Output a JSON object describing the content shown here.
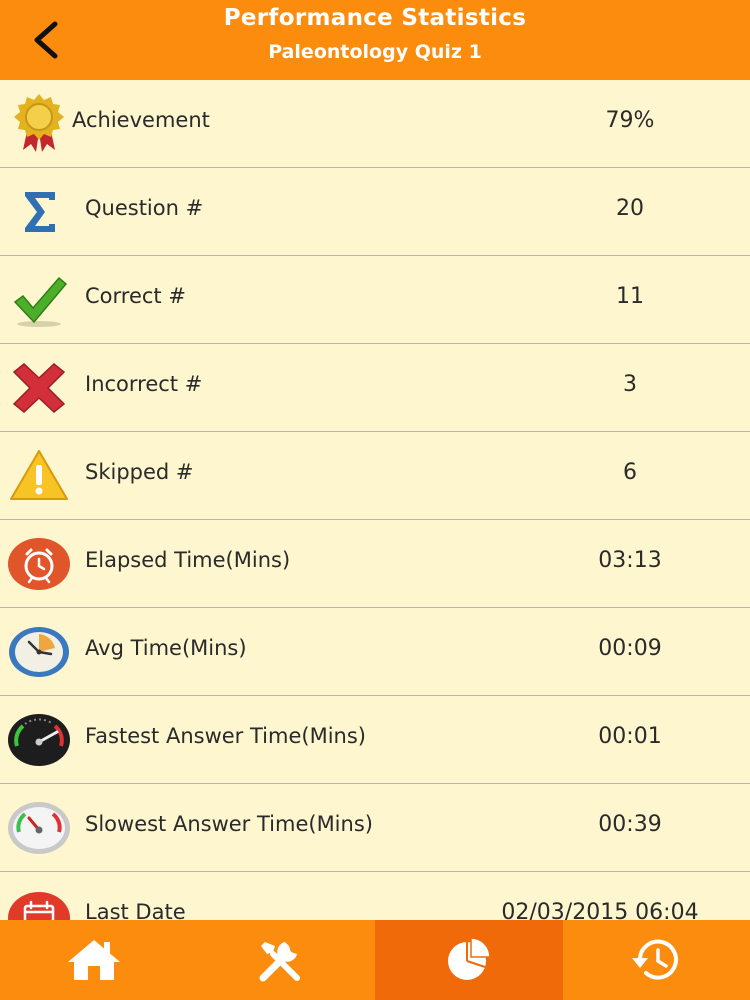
{
  "header": {
    "title": "Performance Statistics",
    "subtitle": "Paleontology Quiz 1"
  },
  "stats": [
    {
      "label": "Achievement",
      "value": "79%",
      "icon": "award-ribbon-icon"
    },
    {
      "label": "Question #",
      "value": "20",
      "icon": "sigma-icon"
    },
    {
      "label": "Correct #",
      "value": "11",
      "icon": "checkmark-icon"
    },
    {
      "label": "Incorrect #",
      "value": "3",
      "icon": "cross-icon"
    },
    {
      "label": "Skipped #",
      "value": "6",
      "icon": "warning-icon"
    },
    {
      "label": "Elapsed Time(Mins)",
      "value": "03:13",
      "icon": "alarm-clock-icon"
    },
    {
      "label": "Avg Time(Mins)",
      "value": "00:09",
      "icon": "clock-icon"
    },
    {
      "label": "Fastest Answer Time(Mins)",
      "value": "00:01",
      "icon": "speedometer-icon"
    },
    {
      "label": "Slowest Answer Time(Mins)",
      "value": "00:39",
      "icon": "gauge-icon"
    },
    {
      "label": "Last Date",
      "value": "02/03/2015 06:04",
      "icon": "calendar-icon"
    }
  ],
  "tabs": [
    "home-icon",
    "tools-icon",
    "pie-chart-icon",
    "history-icon"
  ],
  "colors": {
    "accent": "#fb8c0e",
    "active_tab": "#f06a0a",
    "background": "#fdf6cf"
  }
}
